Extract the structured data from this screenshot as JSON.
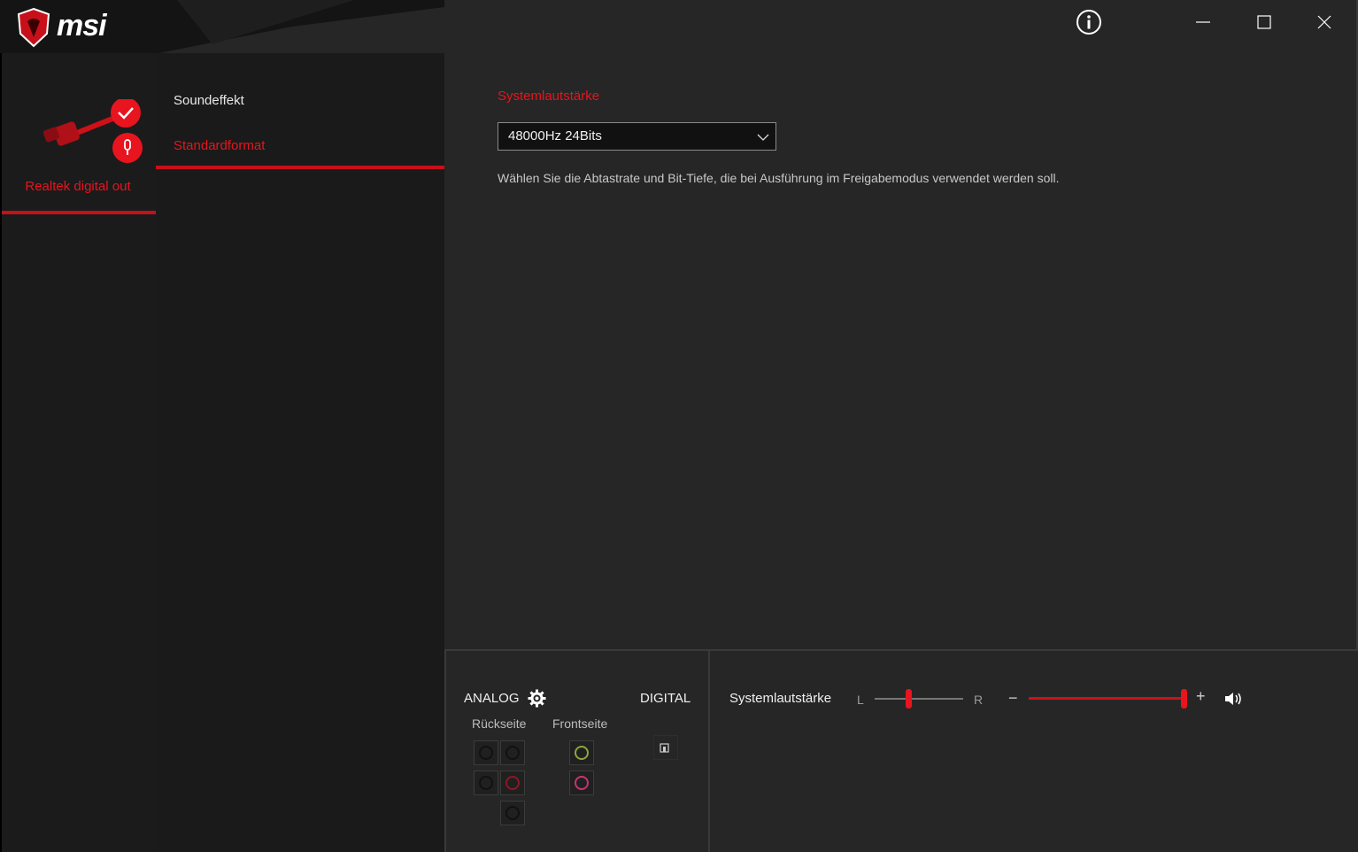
{
  "app": {
    "brand": "msi",
    "accent": "#e8141e"
  },
  "device": {
    "name": "Realtek digital out",
    "icon": "digital-cable-icon"
  },
  "tabs": [
    {
      "label": "Soundeffekt",
      "active": false
    },
    {
      "label": "Standardformat",
      "active": true
    }
  ],
  "content": {
    "section_title": "Systemlautstärke",
    "format_value": "48000Hz 24Bits",
    "description": "Wählen Sie die Abtastrate und Bit-Tiefe, die bei Ausführung im Freigabemodus verwendet werden soll."
  },
  "bottom": {
    "analog_label": "ANALOG",
    "digital_label": "DIGITAL",
    "rear_label": "Rückseite",
    "front_label": "Frontseite",
    "volume_label": "Systemlautstärke",
    "balance_left": "L",
    "balance_right": "R",
    "minus": "−",
    "plus": "+",
    "balance_level": 0.5,
    "volume_level": 1.0,
    "jack_colors": {
      "front_top": "#8aa83c",
      "front_bottom": "#c8346e",
      "rear_red": "#8a1a22"
    }
  }
}
